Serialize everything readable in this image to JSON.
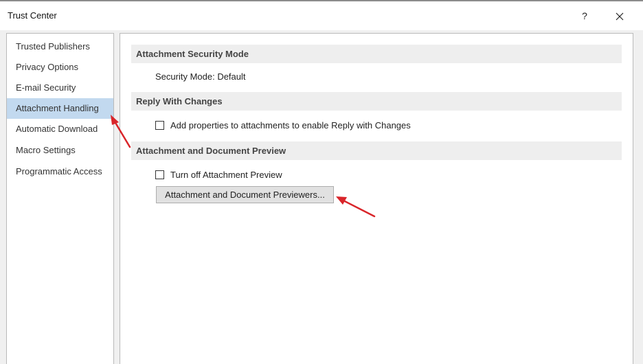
{
  "window": {
    "title": "Trust Center",
    "help_label": "?",
    "close_label": "✕"
  },
  "sidebar": {
    "items": [
      {
        "label": "Trusted Publishers",
        "selected": false
      },
      {
        "label": "Privacy Options",
        "selected": false
      },
      {
        "label": "E-mail Security",
        "selected": false
      },
      {
        "label": "Attachment Handling",
        "selected": true
      },
      {
        "label": "Automatic Download",
        "selected": false
      },
      {
        "label": "Macro Settings",
        "selected": false
      },
      {
        "label": "Programmatic Access",
        "selected": false
      }
    ]
  },
  "main": {
    "security_mode_section": {
      "header": "Attachment Security Mode",
      "text": "Security Mode: Default"
    },
    "reply_section": {
      "header": "Reply With Changes",
      "checkbox_label": "Add properties to attachments to enable Reply with Changes",
      "checked": false
    },
    "preview_section": {
      "header": "Attachment and Document Preview",
      "checkbox_label": "Turn off Attachment Preview",
      "checked": false,
      "button_label": "Attachment and Document Previewers..."
    }
  },
  "colors": {
    "selected_item_bg": "#c2d9ef",
    "section_header_bg": "#eeeeee",
    "annotation_arrow": "#d9252a"
  }
}
